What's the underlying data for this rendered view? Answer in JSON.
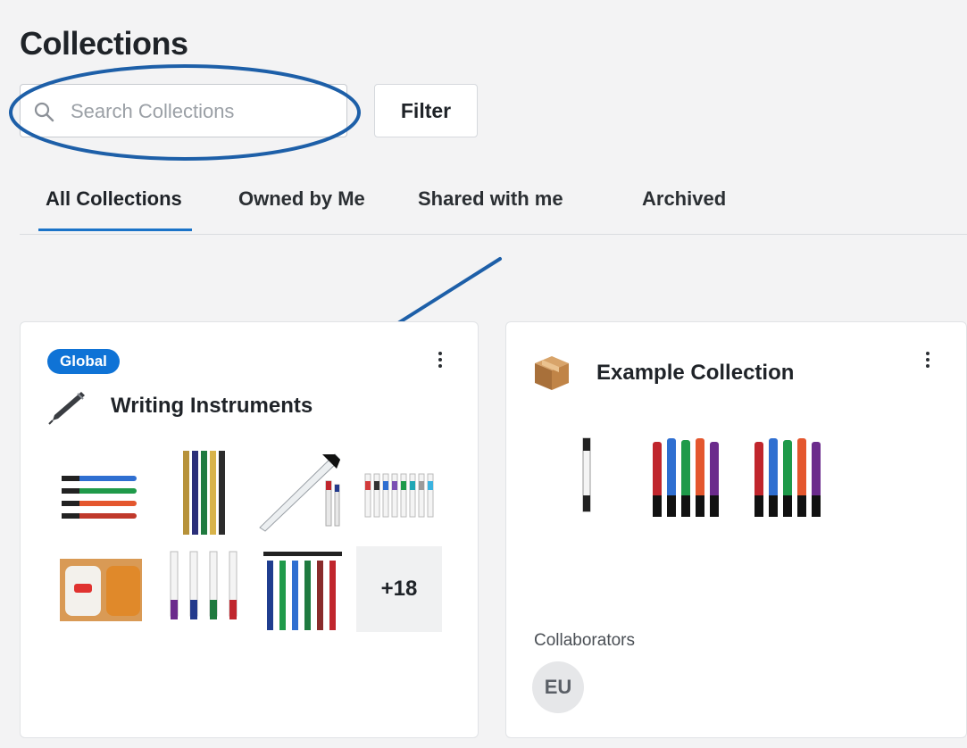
{
  "page": {
    "title": "Collections"
  },
  "search": {
    "placeholder": "Search Collections",
    "value": ""
  },
  "filter": {
    "label": "Filter"
  },
  "tabs": [
    {
      "label": "All Collections",
      "active": true
    },
    {
      "label": "Owned by Me",
      "active": false
    },
    {
      "label": "Shared with me",
      "active": false
    },
    {
      "label": "Archived",
      "active": false
    }
  ],
  "collections": [
    {
      "badge": "Global",
      "icon": "pen-icon",
      "title": "Writing Instruments",
      "thumbnails": [
        "pens-bundle",
        "pencils",
        "marker-pen",
        "pen-set",
        "highlighter-sticks",
        "white-pens",
        "blue-pens"
      ],
      "more_count": "+18"
    },
    {
      "icon": "box-icon",
      "title": "Example Collection",
      "thumbnails": [
        "single-white-pen",
        "colored-pens-1",
        "colored-pens-2"
      ],
      "collaborators_label": "Collaborators",
      "collaborators": [
        {
          "initials": "EU"
        }
      ]
    }
  ],
  "colors": {
    "accent": "#1a73c8",
    "badge": "#0f73d6",
    "annotation": "#1d5fa8"
  }
}
